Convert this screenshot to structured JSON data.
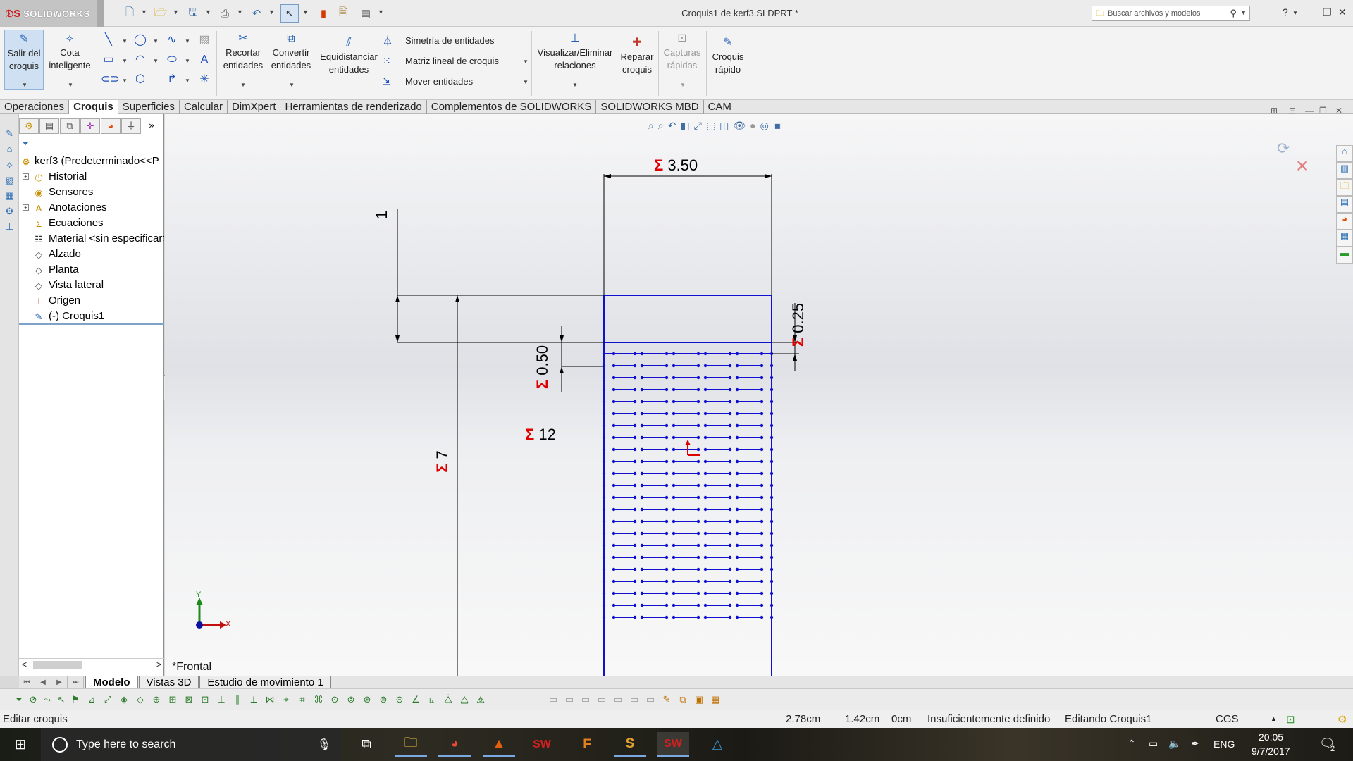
{
  "app": {
    "brand": "SOLIDWORKS",
    "document_title": "Croquis1 de kerf3.SLDPRT *",
    "search_placeholder": "Buscar archivos y modelos",
    "help_label": "?"
  },
  "ribbon": {
    "exit_sketch": "Salir del croquis",
    "smart_dimension": "Cota inteligente",
    "trim": "Recortar entidades",
    "convert": "Convertir entidades",
    "offset": "Equidistanciar entidades",
    "mirror": "Simetría de entidades",
    "linear_pattern": "Matriz lineal de croquis",
    "move": "Mover entidades",
    "display_relations": "Visualizar/Eliminar relaciones",
    "repair": "Reparar croquis",
    "quick_snaps": "Capturas rápidas",
    "rapid_sketch": "Croquis rápido"
  },
  "tabs": [
    {
      "label": "Operaciones"
    },
    {
      "label": "Croquis",
      "active": true
    },
    {
      "label": "Superficies"
    },
    {
      "label": "Calcular"
    },
    {
      "label": "DimXpert"
    },
    {
      "label": "Herramientas de renderizado"
    },
    {
      "label": "Complementos de SOLIDWORKS"
    },
    {
      "label": "SOLIDWORKS MBD"
    },
    {
      "label": "CAM"
    }
  ],
  "tree": {
    "root": "kerf3  (Predeterminado<<P",
    "items": [
      {
        "label": "Historial",
        "icon": "history-icon",
        "expand": true
      },
      {
        "label": "Sensores",
        "icon": "sensor-icon",
        "expand": false
      },
      {
        "label": "Anotaciones",
        "icon": "annotation-icon",
        "expand": true
      },
      {
        "label": "Ecuaciones",
        "icon": "equation-icon",
        "expand": false
      },
      {
        "label": "Material <sin especificar>",
        "icon": "material-icon",
        "expand": false
      },
      {
        "label": "Alzado",
        "icon": "plane-icon",
        "expand": false
      },
      {
        "label": "Planta",
        "icon": "plane-icon",
        "expand": false
      },
      {
        "label": "Vista lateral",
        "icon": "plane-icon",
        "expand": false
      },
      {
        "label": "Origen",
        "icon": "origin-icon",
        "expand": false
      },
      {
        "label": "(-) Croquis1",
        "icon": "sketch-icon",
        "expand": false
      }
    ]
  },
  "viewport": {
    "view_name": "*Frontal",
    "sigma": "Σ",
    "dims": {
      "width": "3.50",
      "top_gap": "1",
      "kerf": "0.25",
      "spacing": "0.50",
      "count": "12",
      "height": "7"
    },
    "axis_x": "X",
    "axis_y": "Y",
    "sketch_color": "#1010d0",
    "sigma_color": "#e00000"
  },
  "bottom_tabs": [
    {
      "label": "Modelo",
      "active": true
    },
    {
      "label": "Vistas 3D"
    },
    {
      "label": "Estudio de movimiento 1"
    }
  ],
  "status": {
    "left": "Editar croquis",
    "x": "2.78cm",
    "y": "1.42cm",
    "z": "0cm",
    "definition": "Insuficientemente definido",
    "editing": "Editando Croquis1",
    "units": "CGS"
  },
  "taskbar": {
    "search_placeholder": "Type here to search",
    "lang": "ENG",
    "time": "20:05",
    "date": "9/7/2017",
    "notifications": "2"
  }
}
